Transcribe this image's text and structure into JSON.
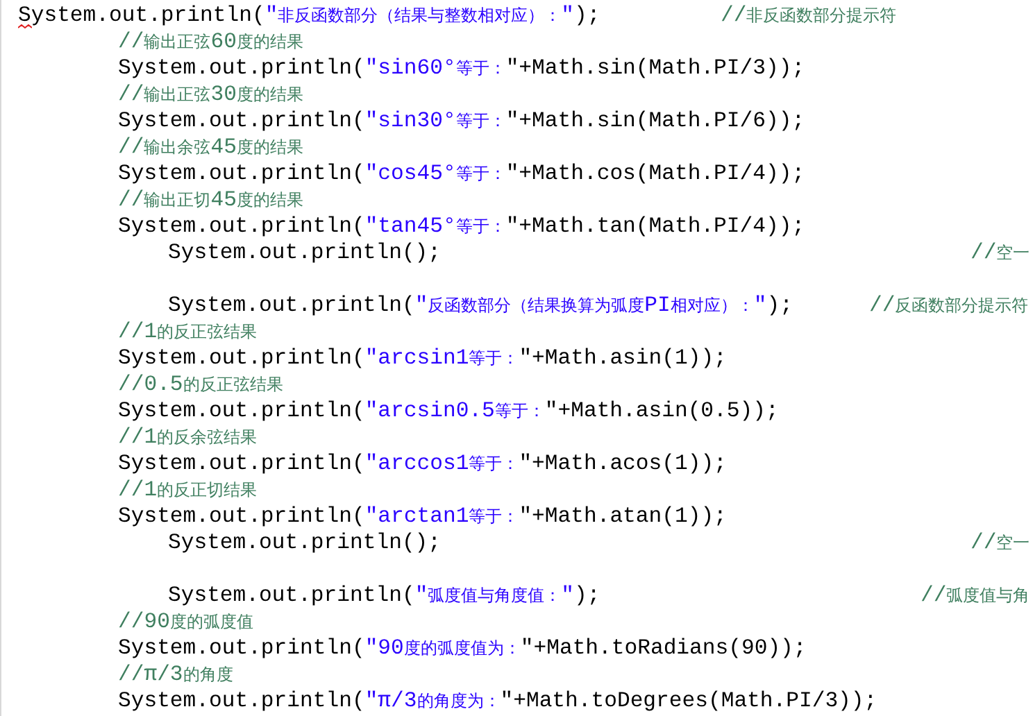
{
  "lines": [
    {
      "kind": "outer",
      "segments": [
        {
          "kind": "code",
          "text": "S",
          "misspelled": true
        },
        {
          "kind": "code",
          "text": "ystem.out.println("
        },
        {
          "kind": "string",
          "text": "\"非反函数部分（结果与整数相对应）：\""
        },
        {
          "kind": "code",
          "text": ");"
        }
      ],
      "comment": "//非反函数部分提示符"
    },
    {
      "kind": "body",
      "segments": [
        {
          "kind": "comment",
          "text": "//输出正弦60度的结果"
        }
      ]
    },
    {
      "kind": "body",
      "segments": [
        {
          "kind": "code",
          "text": "System.out.println("
        },
        {
          "kind": "string",
          "text": "\"sin60°等于："
        },
        {
          "kind": "code",
          "text": "\"+Math.sin(Math.PI/3));"
        }
      ]
    },
    {
      "kind": "body",
      "segments": [
        {
          "kind": "comment",
          "text": "//输出正弦30度的结果"
        }
      ]
    },
    {
      "kind": "body",
      "segments": [
        {
          "kind": "code",
          "text": "System.out.println("
        },
        {
          "kind": "string",
          "text": "\"sin30°等于："
        },
        {
          "kind": "code",
          "text": "\"+Math.sin(Math.PI/6));"
        }
      ]
    },
    {
      "kind": "body",
      "segments": [
        {
          "kind": "comment",
          "text": "//输出余弦45度的结果"
        }
      ]
    },
    {
      "kind": "body",
      "segments": [
        {
          "kind": "code",
          "text": "System.out.println("
        },
        {
          "kind": "string",
          "text": "\"cos45°等于："
        },
        {
          "kind": "code",
          "text": "\"+Math.cos(Math.PI/4));"
        }
      ]
    },
    {
      "kind": "body",
      "segments": [
        {
          "kind": "comment",
          "text": "//输出正切45度的结果"
        }
      ]
    },
    {
      "kind": "body",
      "segments": [
        {
          "kind": "code",
          "text": "System.out.println("
        },
        {
          "kind": "string",
          "text": "\"tan45°等于："
        },
        {
          "kind": "code",
          "text": "\"+Math.tan(Math.PI/4));"
        }
      ]
    },
    {
      "kind": "inner",
      "segments": [
        {
          "kind": "code",
          "text": "System.out.println();"
        }
      ],
      "comment": "//空一"
    },
    {
      "kind": "blank"
    },
    {
      "kind": "inner",
      "segments": [
        {
          "kind": "code",
          "text": "System.out.println("
        },
        {
          "kind": "string",
          "text": "\"反函数部分（结果换算为弧度PI相对应）：\""
        },
        {
          "kind": "code",
          "text": ");"
        }
      ],
      "comment": "//反函数部分提示符"
    },
    {
      "kind": "body",
      "segments": [
        {
          "kind": "comment",
          "text": "//1的反正弦结果"
        }
      ]
    },
    {
      "kind": "body",
      "segments": [
        {
          "kind": "code",
          "text": "System.out.println("
        },
        {
          "kind": "string",
          "text": "\"arcsin1等于："
        },
        {
          "kind": "code",
          "text": "\"+Math.asin(1));"
        }
      ]
    },
    {
      "kind": "body",
      "segments": [
        {
          "kind": "comment",
          "text": "//0.5的反正弦结果"
        }
      ]
    },
    {
      "kind": "body",
      "segments": [
        {
          "kind": "code",
          "text": "System.out.println("
        },
        {
          "kind": "string",
          "text": "\"arcsin0.5等于："
        },
        {
          "kind": "code",
          "text": "\"+Math.asin(0.5));"
        }
      ]
    },
    {
      "kind": "body",
      "segments": [
        {
          "kind": "comment",
          "text": "//1的反余弦结果"
        }
      ]
    },
    {
      "kind": "body",
      "segments": [
        {
          "kind": "code",
          "text": "System.out.println("
        },
        {
          "kind": "string",
          "text": "\"arccos1等于："
        },
        {
          "kind": "code",
          "text": "\"+Math.acos(1));"
        }
      ]
    },
    {
      "kind": "body",
      "segments": [
        {
          "kind": "comment",
          "text": "//1的反正切结果"
        }
      ]
    },
    {
      "kind": "body",
      "segments": [
        {
          "kind": "code",
          "text": "System.out.println("
        },
        {
          "kind": "string",
          "text": "\"arctan1等于："
        },
        {
          "kind": "code",
          "text": "\"+Math.atan(1));"
        }
      ]
    },
    {
      "kind": "inner",
      "segments": [
        {
          "kind": "code",
          "text": "System.out.println();"
        }
      ],
      "comment": "//空一"
    },
    {
      "kind": "blank"
    },
    {
      "kind": "inner",
      "segments": [
        {
          "kind": "code",
          "text": "System.out.println("
        },
        {
          "kind": "string",
          "text": "\"弧度值与角度值：\""
        },
        {
          "kind": "code",
          "text": ");"
        }
      ],
      "comment": "//弧度值与角"
    },
    {
      "kind": "body",
      "segments": [
        {
          "kind": "comment",
          "text": "//90度的弧度值"
        }
      ]
    },
    {
      "kind": "body",
      "segments": [
        {
          "kind": "code",
          "text": "System.out.println("
        },
        {
          "kind": "string",
          "text": "\"90度的弧度值为："
        },
        {
          "kind": "code",
          "text": "\"+Math.toRadians(90));"
        }
      ]
    },
    {
      "kind": "body",
      "segments": [
        {
          "kind": "comment",
          "text": "//π/3的角度"
        }
      ]
    },
    {
      "kind": "body",
      "segments": [
        {
          "kind": "code",
          "text": "System.out.println("
        },
        {
          "kind": "string",
          "text": "\"π/3的角度为："
        },
        {
          "kind": "code",
          "text": "\"+Math.toDegrees(Math.PI/3));"
        }
      ]
    }
  ]
}
